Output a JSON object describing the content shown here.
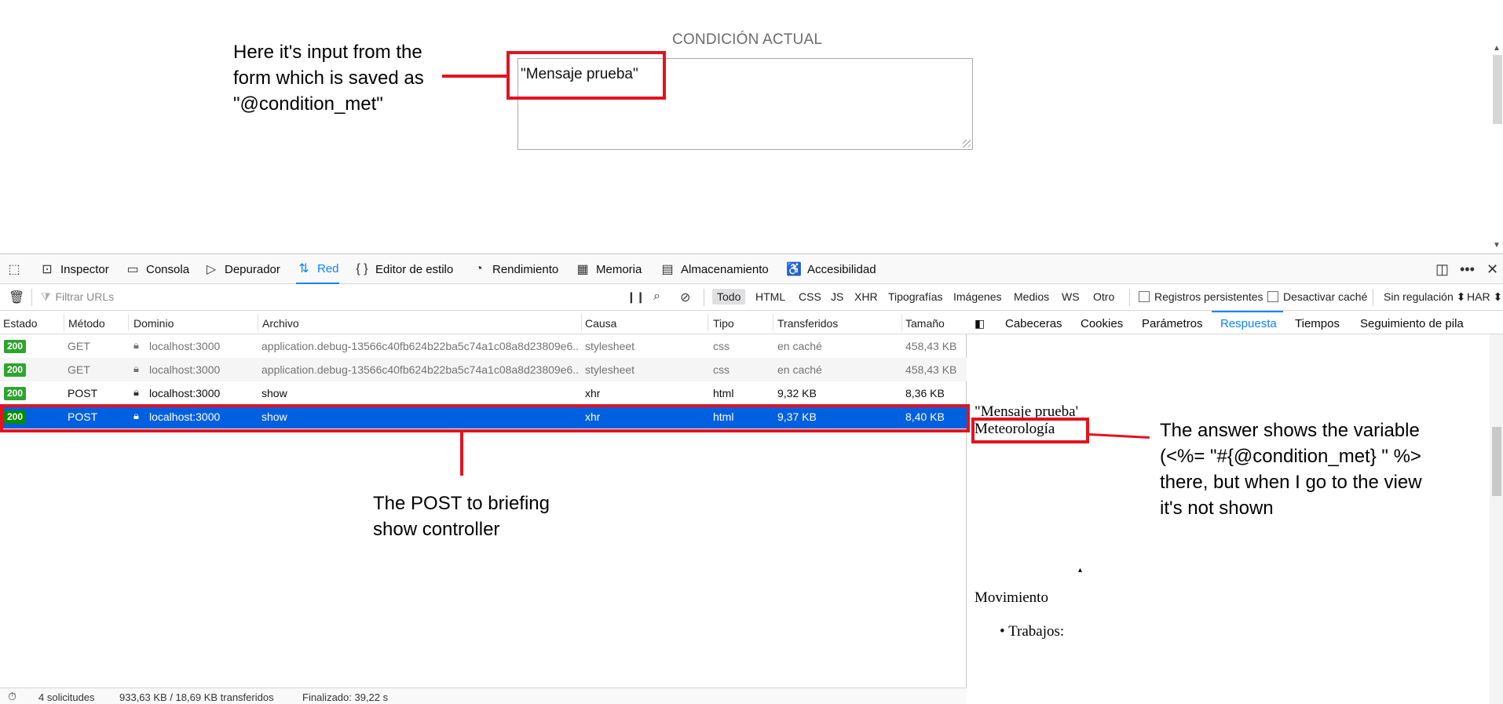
{
  "page": {
    "section_title": "CONDICIÓN ACTUAL",
    "textarea_value": "\"Mensaje prueba\""
  },
  "annotations": {
    "input_note": [
      "Here it's input from the",
      "form which is saved as",
      "\"@condition_met\""
    ],
    "post_note": [
      "The POST to briefing",
      "show controller"
    ],
    "answer_note": [
      "The answer shows the variable",
      "(<%= \"#{@condition_met} \" %>",
      "there, but when I go to the view",
      "it's not shown"
    ]
  },
  "devtools": {
    "tabs": [
      {
        "label": "Inspector",
        "icon": "inspector-icon"
      },
      {
        "label": "Consola",
        "icon": "console-icon"
      },
      {
        "label": "Depurador",
        "icon": "debugger-icon"
      },
      {
        "label": "Red",
        "icon": "network-icon",
        "active": true
      },
      {
        "label": "Editor de estilo",
        "icon": "style-editor-icon"
      },
      {
        "label": "Rendimiento",
        "icon": "performance-icon"
      },
      {
        "label": "Memoria",
        "icon": "memory-icon"
      },
      {
        "label": "Almacenamiento",
        "icon": "storage-icon"
      },
      {
        "label": "Accesibilidad",
        "icon": "accessibility-icon"
      }
    ],
    "filter": {
      "placeholder": "Filtrar URLs",
      "types": [
        "Todo",
        "HTML",
        "CSS",
        "JS",
        "XHR",
        "Tipografías",
        "Imágenes",
        "Medios",
        "WS",
        "Otro"
      ],
      "selected_type": "Todo",
      "persist_logs": "Registros persistentes",
      "disable_cache": "Desactivar caché",
      "throttling": "Sin regulación",
      "har": "HAR"
    },
    "columns": [
      "Estado",
      "Método",
      "Dominio",
      "Archivo",
      "Causa",
      "Tipo",
      "Transferidos",
      "Tamaño"
    ],
    "rows": [
      {
        "status": "200",
        "method": "GET",
        "domain": "localhost:3000",
        "file": "application.debug-13566c40fb624b22ba5c74a1c08a8d23809e6...",
        "cause": "stylesheet",
        "type": "css",
        "transferred": "en caché",
        "size": "458,43 KB"
      },
      {
        "status": "200",
        "method": "GET",
        "domain": "localhost:3000",
        "file": "application.debug-13566c40fb624b22ba5c74a1c08a8d23809e6...",
        "cause": "stylesheet",
        "type": "css",
        "transferred": "en caché",
        "size": "458,43 KB"
      },
      {
        "status": "200",
        "method": "POST",
        "domain": "localhost:3000",
        "file": "show",
        "cause": "xhr",
        "type": "html",
        "transferred": "9,32 KB",
        "size": "8,36 KB"
      },
      {
        "status": "200",
        "method": "POST",
        "domain": "localhost:3000",
        "file": "show",
        "cause": "xhr",
        "type": "html",
        "transferred": "9,37 KB",
        "size": "8,40 KB",
        "selected": true
      }
    ],
    "side_tabs": [
      "Cabeceras",
      "Cookies",
      "Parámetros",
      "Respuesta",
      "Tiempos",
      "Seguimiento de pila"
    ],
    "side_active": "Respuesta",
    "response": {
      "line1": "\"Mensaje prueba'",
      "line2": "Meteorología",
      "line3": "Movimiento",
      "bullet1": "Trabajos:"
    },
    "status": {
      "requests": "4 solicitudes",
      "transferred": "933,63 KB / 18,69 KB transferidos",
      "finished": "Finalizado: 39,22 s"
    }
  },
  "colors": {
    "accent": "#0a84ff",
    "selected_row": "#0060df",
    "status_ok": "#2ea42e",
    "annotation_red": "#e3131f"
  }
}
